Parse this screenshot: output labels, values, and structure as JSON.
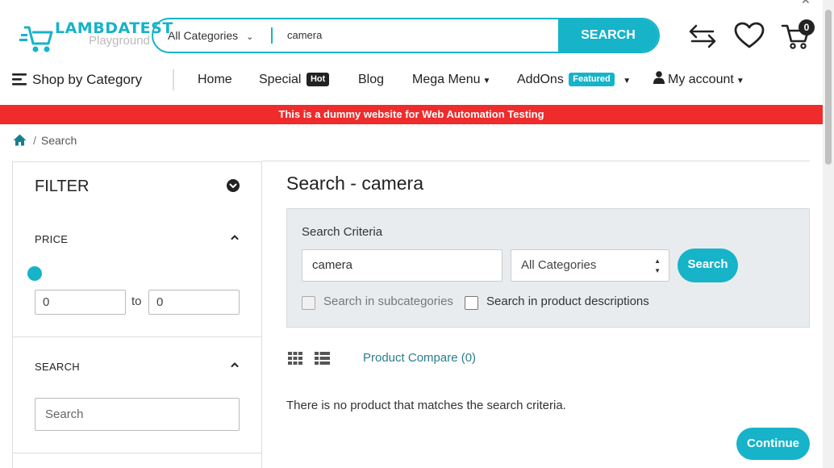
{
  "logo": {
    "brand": "LAMBDATEST",
    "sub": "Playground"
  },
  "search": {
    "category": "All Categories",
    "value": "camera",
    "button": "SEARCH"
  },
  "cart": {
    "count": "0"
  },
  "nav": {
    "shop_by_category": "Shop by Category",
    "home": "Home",
    "special": "Special",
    "special_tag": "Hot",
    "blog": "Blog",
    "mega_menu": "Mega Menu",
    "addons": "AddOns",
    "addons_tag": "Featured",
    "my_account": "My account"
  },
  "banner": "This is a dummy website for Web Automation Testing",
  "breadcrumb": {
    "current": "Search"
  },
  "filter": {
    "title": "FILTER",
    "price_title": "PRICE",
    "price_min": "0",
    "price_max": "0",
    "to_label": "to",
    "search_title": "SEARCH",
    "search_placeholder": "Search"
  },
  "main": {
    "title": "Search - camera",
    "criteria_label": "Search Criteria",
    "criteria_value": "camera",
    "category_select": "All Categories",
    "search_button": "Search",
    "subcategories_label": "Search in subcategories",
    "descriptions_label": "Search in product descriptions",
    "compare_link": "Product Compare (0)",
    "no_product_message": "There is no product that matches the search criteria.",
    "continue_button": "Continue"
  },
  "colors": {
    "accent": "#16b3c9",
    "banner": "#ef2b2b"
  }
}
